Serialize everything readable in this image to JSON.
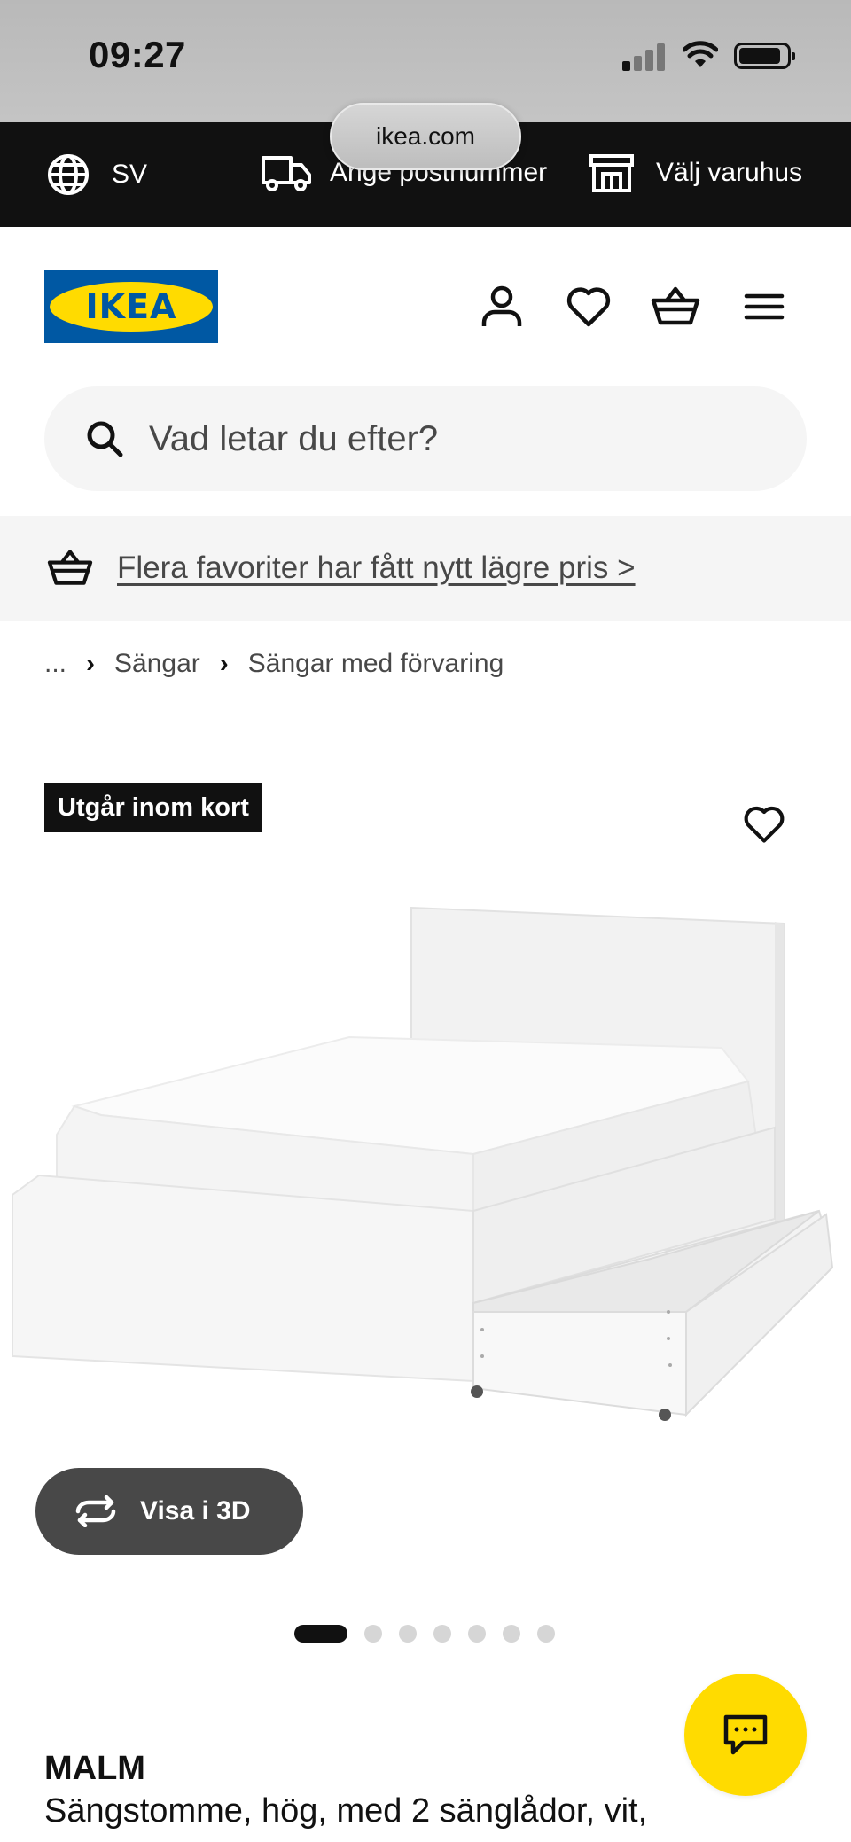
{
  "status_bar": {
    "time": "09:27",
    "signal_bars_active": 1,
    "signal_bars_total": 4
  },
  "browser": {
    "url": "ikea.com"
  },
  "top_bar": {
    "language": "SV",
    "postcode_label": "Ange postnummer",
    "store_label": "Välj varuhus"
  },
  "header": {
    "logo_text": "IKEA",
    "icons": [
      "user-icon",
      "heart-icon",
      "basket-icon",
      "menu-icon"
    ]
  },
  "search": {
    "placeholder": "Vad letar du efter?"
  },
  "promo": {
    "text": "Flera favoriter har fått nytt lägre pris >"
  },
  "breadcrumb": {
    "ellipsis": "...",
    "items": [
      "Sängar",
      "Sängar med förvaring"
    ]
  },
  "product": {
    "badge": "Utgår inom kort",
    "view_3d_label": "Visa i 3D",
    "image_count": 7,
    "active_image": 1,
    "name": "MALM",
    "description": "Sängstomme, hög, med 2 sänglådor, vit,"
  },
  "colors": {
    "ikea_blue": "#0058a3",
    "ikea_yellow": "#ffdb00",
    "dark": "#111111",
    "button_grey": "#484848"
  }
}
